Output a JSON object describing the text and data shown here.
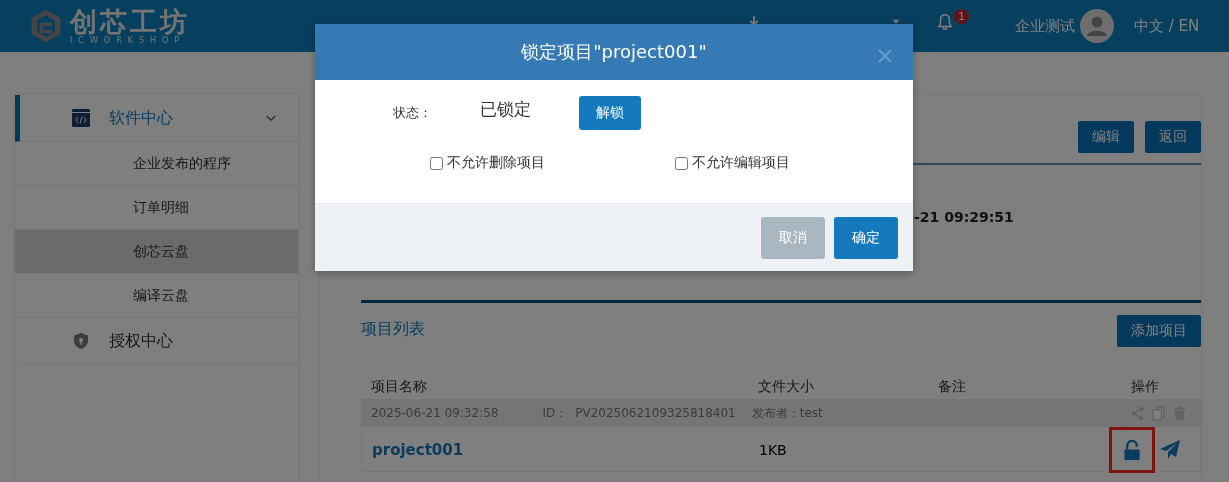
{
  "header": {
    "logo": {
      "name": "创芯工坊",
      "tagline": "ICWORKSHOP"
    },
    "notifications": {
      "count": "1"
    },
    "user": {
      "name": "企业测试"
    },
    "language": "中文 / EN"
  },
  "sidebar": {
    "items": [
      {
        "label": "软件中心",
        "selected": true,
        "children": [
          {
            "label": "企业发布的程序",
            "selected": false
          },
          {
            "label": "订单明细",
            "selected": false
          },
          {
            "label": "创芯云盘",
            "selected": true
          },
          {
            "label": "编译云盘",
            "selected": false
          }
        ]
      },
      {
        "label": "授权中心",
        "selected": false
      }
    ]
  },
  "content": {
    "actions": [
      "编辑",
      "返回"
    ],
    "info_fragment": "-21 09:29:51",
    "projects": {
      "title": "项目列表",
      "add_button": "添加项目",
      "columns": [
        "项目名称",
        "文件大小",
        "备注",
        "操作"
      ],
      "rows": [
        {
          "date": "2025-06-21 09:32:58",
          "id_label": "ID：",
          "id": "PV2025062109325818401",
          "publisher": "发布者：test",
          "name": "project001",
          "size": "1KB",
          "locked": false,
          "highlighted": true
        }
      ]
    }
  },
  "modal": {
    "title": "锁定项目\"project001\"",
    "status_label": "状态：",
    "status": "已锁定",
    "unlock_button": "解锁",
    "options": [
      {
        "label": "不允许删除项目",
        "checked": false
      },
      {
        "label": "不允许编辑项目",
        "checked": false
      }
    ],
    "buttons": [
      {
        "label": "取消",
        "kind": "cancel"
      },
      {
        "label": "确定",
        "kind": "primary"
      }
    ]
  }
}
